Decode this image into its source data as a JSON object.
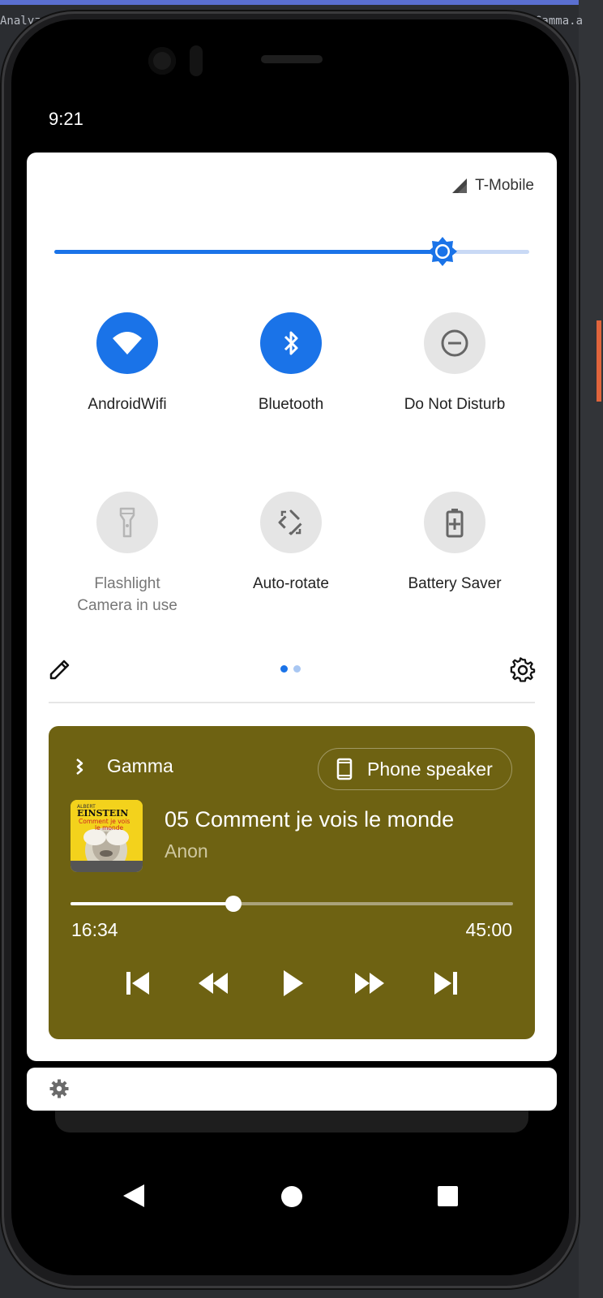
{
  "background": {
    "title_left": "Analyze",
    "title_right": "Gamma.a"
  },
  "status_bar": {
    "time": "9:21"
  },
  "quick_settings": {
    "carrier": "T-Mobile",
    "brightness_level": 0.818,
    "tiles": [
      {
        "label": "AndroidWifi",
        "state": "on",
        "icon": "wifi-icon"
      },
      {
        "label": "Bluetooth",
        "state": "on",
        "icon": "bluetooth-icon"
      },
      {
        "label": "Do Not Disturb",
        "state": "off",
        "icon": "do-not-disturb-icon"
      },
      {
        "label": "Flashlight",
        "sublabel": "Camera in use",
        "state": "unavailable",
        "icon": "flashlight-icon"
      },
      {
        "label": "Auto-rotate",
        "state": "off",
        "icon": "auto-rotate-icon"
      },
      {
        "label": "Battery Saver",
        "state": "off",
        "icon": "battery-saver-icon"
      }
    ],
    "page_count": 2,
    "current_page": 1
  },
  "media": {
    "app_name": "Gamma",
    "output_device": "Phone speaker",
    "title": "05 Comment je vois le monde",
    "artist": "Anon",
    "album_art_text": {
      "top": "ALBERT",
      "name": "EINSTEIN",
      "line1": "Comment je vois",
      "line2": "le monde"
    },
    "elapsed": "16:34",
    "duration": "45:00",
    "progress": 0.368,
    "colors": {
      "card_background": "#6e6212"
    }
  },
  "colors": {
    "accent": "#1a73e8",
    "tile_off": "#e5e5e5"
  }
}
